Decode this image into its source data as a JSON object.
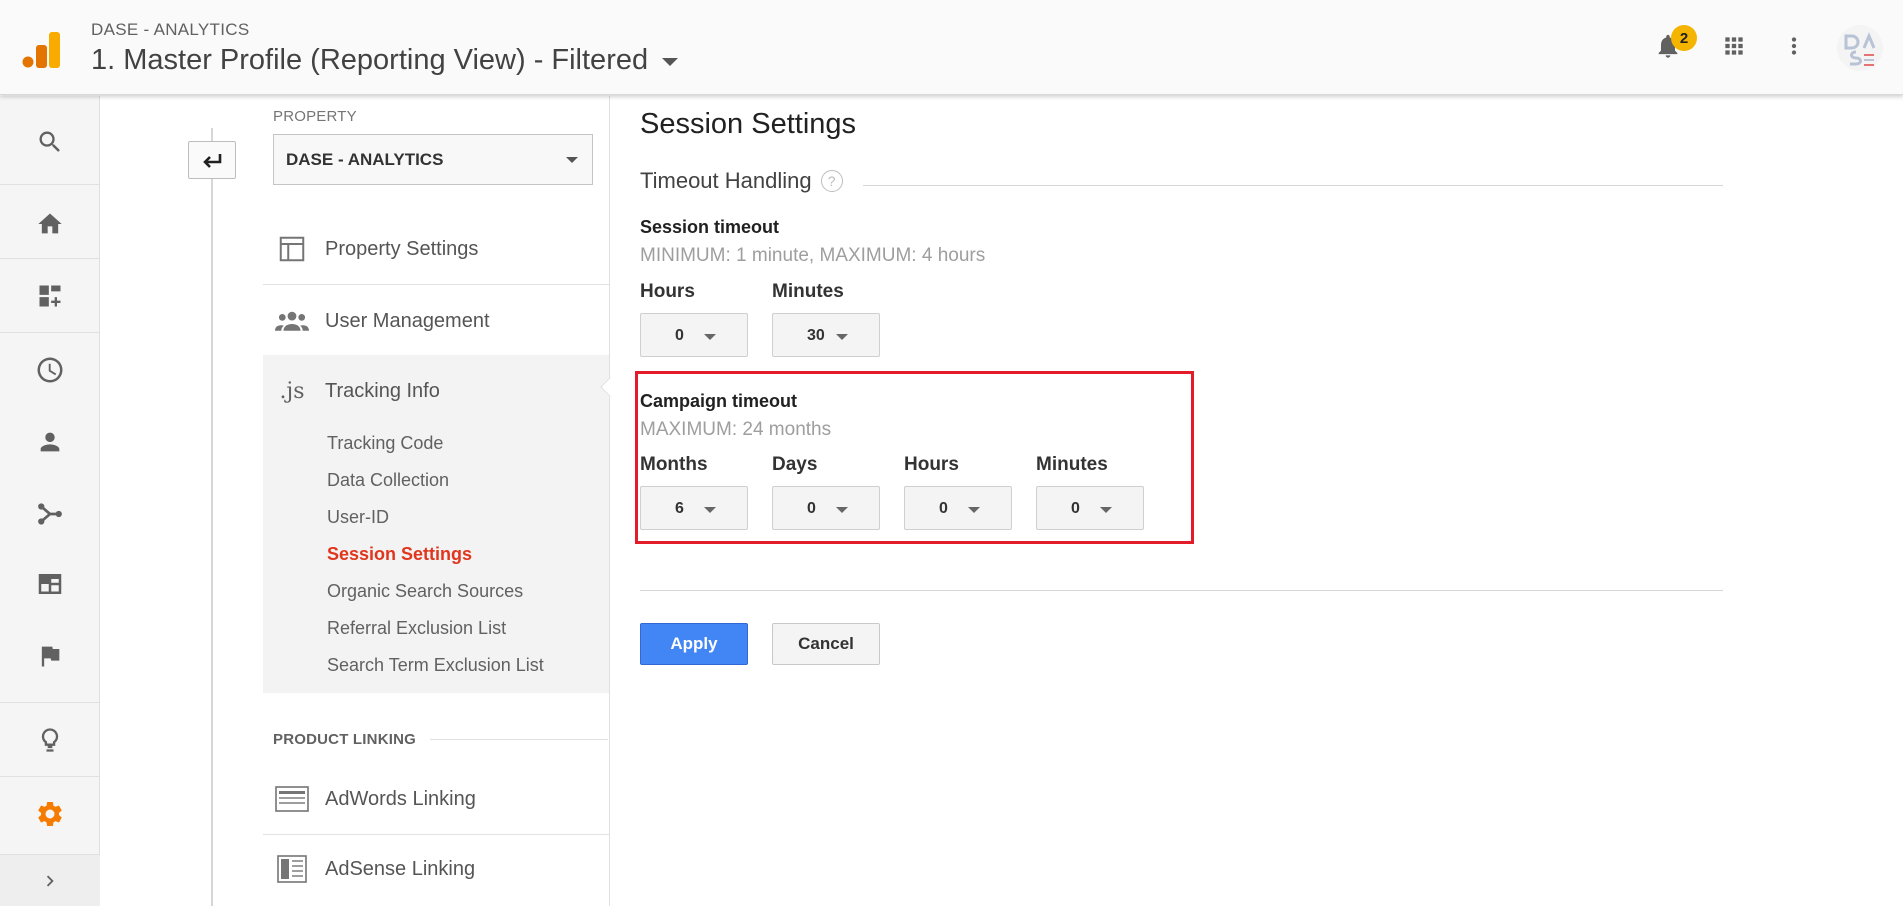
{
  "header": {
    "account_name": "DASE - ANALYTICS",
    "view_title": "1. Master Profile (Reporting View) - Filtered",
    "notification_count": "2"
  },
  "rail": {
    "items": [
      "search-icon",
      "home-icon",
      "customization-icon",
      "realtime-icon",
      "audience-icon",
      "acquisition-icon",
      "behavior-icon",
      "conversions-icon",
      "discover-icon",
      "admin-icon",
      "expand-icon"
    ],
    "active_color": "#f57c00"
  },
  "nav": {
    "property_label": "PROPERTY",
    "property_value": "DASE - ANALYTICS",
    "items": [
      {
        "label": "Property Settings"
      },
      {
        "label": "User Management"
      },
      {
        "label": "Tracking Info"
      }
    ],
    "tracking_sub": [
      {
        "label": "Tracking Code"
      },
      {
        "label": "Data Collection"
      },
      {
        "label": "User-ID"
      },
      {
        "label": "Session Settings"
      },
      {
        "label": "Organic Search Sources"
      },
      {
        "label": "Referral Exclusion List"
      },
      {
        "label": "Search Term Exclusion List"
      }
    ],
    "product_linking_header": "PRODUCT LINKING",
    "linking_items": [
      {
        "label": "AdWords Linking"
      },
      {
        "label": "AdSense Linking"
      }
    ]
  },
  "main": {
    "page_title": "Session Settings",
    "section_title": "Timeout Handling",
    "help_glyph": "?",
    "session": {
      "title": "Session timeout",
      "subtitle": "MINIMUM: 1 minute, MAXIMUM: 4 hours",
      "hours_label": "Hours",
      "hours_value": "0",
      "minutes_label": "Minutes",
      "minutes_value": "30"
    },
    "campaign": {
      "title": "Campaign timeout",
      "subtitle": "MAXIMUM: 24 months",
      "months_label": "Months",
      "months_value": "6",
      "days_label": "Days",
      "days_value": "0",
      "hours_label": "Hours",
      "hours_value": "0",
      "minutes_label": "Minutes",
      "minutes_value": "0"
    },
    "apply_label": "Apply",
    "cancel_label": "Cancel"
  },
  "colors": {
    "accent": "#4285f4",
    "active_link": "#e0361e",
    "highlight": "#e41c2a",
    "badge": "#f4b400"
  }
}
